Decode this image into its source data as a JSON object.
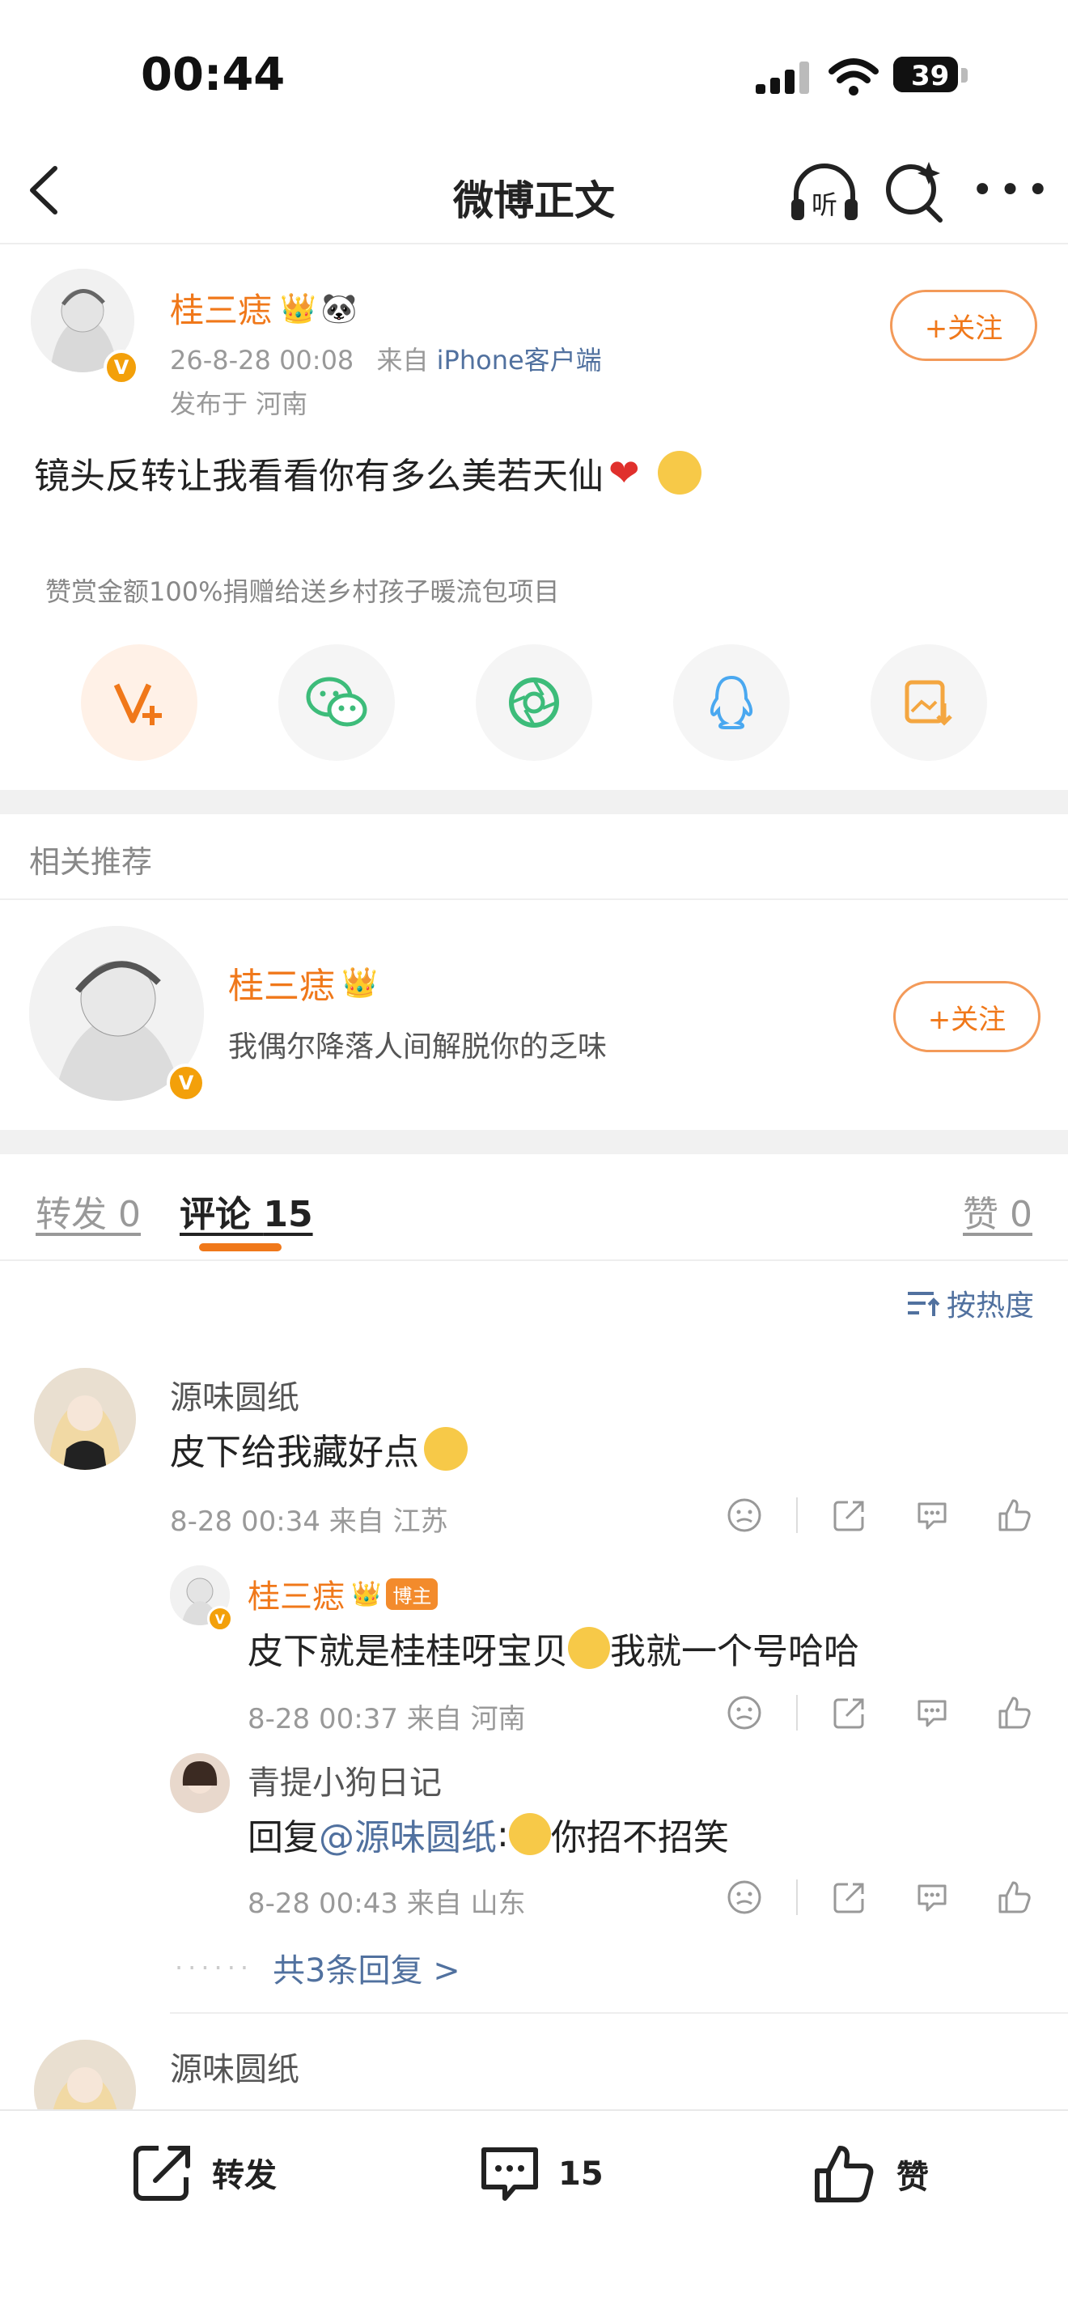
{
  "status": {
    "time": "00:44",
    "battery": "39"
  },
  "header": {
    "title": "微博正文"
  },
  "post": {
    "author": "桂三痣",
    "time": "26-8-28 00:08",
    "source_prefix": "来自",
    "client": "iPhone客户端",
    "location": "发布于 河南",
    "follow_label": "+关注",
    "content": "镜头反转让我看看你有多么美若天仙",
    "donate_text": "赞赏金额100%捐赠给送乡村孩子暖流包项目"
  },
  "related": {
    "title": "相关推荐",
    "name": "桂三痣",
    "desc": "我偶尔降落人间解脱你的乏味",
    "follow_label": "+关注"
  },
  "tabs": {
    "repost_label": "转发",
    "repost_count": "0",
    "comment_label": "评论",
    "comment_count": "15",
    "like_label": "赞",
    "like_count": "0"
  },
  "sort_label": "按热度",
  "comments": [
    {
      "name": "源味圆纸",
      "text": "皮下给我藏好点",
      "meta": "8-28 00:34  来自 江苏",
      "replies": [
        {
          "name": "桂三痣",
          "badge": "博主",
          "text_a": "皮下就是桂桂呀宝贝",
          "text_b": "我就一个号哈哈",
          "meta": "8-28 00:37  来自 河南"
        },
        {
          "name": "青提小狗日记",
          "text_a": "回复",
          "mention": "@源味圆纸",
          "text_b": ":",
          "text_c": "你招不招笑",
          "meta": "8-28 00:43  来自 山东"
        }
      ],
      "more_replies": "共3条回复 >"
    },
    {
      "name": "源味圆纸"
    }
  ],
  "bottom": {
    "repost": "转发",
    "comment_count": "15",
    "like": "赞"
  },
  "colors": {
    "accent": "#f0781a",
    "link": "#51719f"
  }
}
